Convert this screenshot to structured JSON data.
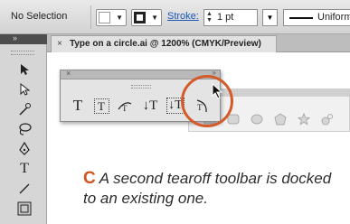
{
  "control_bar": {
    "selection_label": "No Selection",
    "stroke_label": "Stroke:",
    "stroke_value": "1 pt",
    "brush_label": "Uniform"
  },
  "document": {
    "tab_close": "×",
    "tab_title": "Type on a circle.ai @ 1200% (CMYK/Preview)"
  },
  "panels": {
    "collapse_glyph": "»",
    "close_glyph": "×"
  },
  "tools": [
    {
      "icon": "selection-arrow-icon"
    },
    {
      "icon": "direct-selection-icon"
    },
    {
      "icon": "magic-wand-icon"
    },
    {
      "icon": "lasso-icon"
    },
    {
      "icon": "pen-icon"
    },
    {
      "icon": "type-icon",
      "glyph": "T"
    },
    {
      "icon": "line-segment-icon"
    },
    {
      "icon": "rectangle-icon"
    }
  ],
  "type_toolbar": {
    "tools": [
      {
        "icon": "type-icon",
        "glyph": "T"
      },
      {
        "icon": "area-type-icon",
        "glyph": "T"
      },
      {
        "icon": "type-on-path-icon"
      },
      {
        "icon": "vertical-type-icon",
        "glyph": "↓T"
      },
      {
        "icon": "vertical-area-type-icon",
        "glyph": "↓T"
      },
      {
        "icon": "vertical-type-on-path-icon"
      }
    ]
  },
  "shape_toolbar": {
    "tools": [
      {
        "icon": "rectangle-icon"
      },
      {
        "icon": "rounded-rectangle-icon"
      },
      {
        "icon": "ellipse-icon"
      },
      {
        "icon": "polygon-icon"
      },
      {
        "icon": "star-icon"
      },
      {
        "icon": "flare-icon"
      }
    ]
  },
  "caption": {
    "letter": "C",
    "text": "A second tearoff toolbar is docked to an existing one."
  },
  "colors": {
    "accent": "#d0541f",
    "highlight_circle": "#d45a2a",
    "link": "#1a55b5"
  }
}
